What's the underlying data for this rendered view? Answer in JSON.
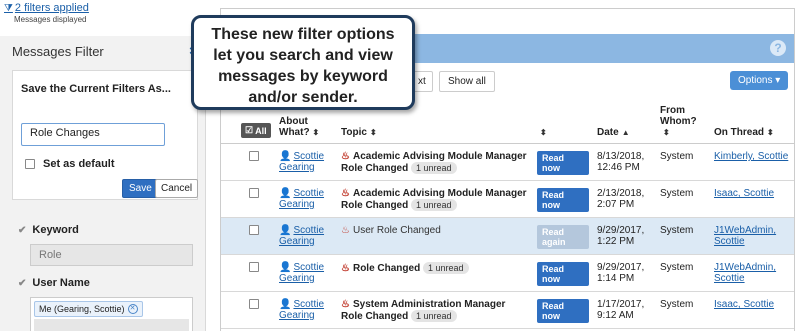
{
  "filters_applied": {
    "label": "2 filters applied",
    "sub": "Messages displayed"
  },
  "sidebar": {
    "title": "Messages Filter",
    "save_label": "Save the Current Filters As...",
    "save_value": "Role Changes",
    "set_default_label": "Set as default",
    "save_button": "Save",
    "cancel_button": "Cancel",
    "keyword_label": "Keyword",
    "keyword_value": "Role",
    "username_label": "User Name",
    "user_tag": "Me (Gearing, Scottie)"
  },
  "toolbar": {
    "next_label": "xt",
    "show_all_label": "Show all",
    "options_label": "Options ▾"
  },
  "callout": "These new filter options let you search and view messages by keyword and/or sender.",
  "table": {
    "headers": {
      "all": "All",
      "about": "About What?",
      "topic": "Topic",
      "date": "Date",
      "from": "From Whom?",
      "thread": "On Thread"
    },
    "rows": [
      {
        "about": "Scottie Gearing",
        "topic": "Academic Advising Module Manager Role Changed",
        "unread": "1 unread",
        "action": "Read now",
        "date": "8/13/2018, 12:46 PM",
        "from": "System",
        "thread": "Kimberly, Scottie"
      },
      {
        "about": "Scottie Gearing",
        "topic": "Academic Advising Module Manager Role Changed",
        "unread": "1 unread",
        "action": "Read now",
        "date": "2/13/2018, 2:07 PM",
        "from": "System",
        "thread": "Isaac, Scottie"
      },
      {
        "about": "Scottie Gearing",
        "topic": "User Role Changed",
        "unread": "",
        "action": "Read again",
        "date": "9/29/2017, 1:22 PM",
        "from": "System",
        "thread": "J1WebAdmin, Scottie"
      },
      {
        "about": "Scottie Gearing",
        "topic": "Role Changed",
        "unread": "1 unread",
        "action": "Read now",
        "date": "9/29/2017, 1:14 PM",
        "from": "System",
        "thread": "J1WebAdmin, Scottie"
      },
      {
        "about": "Scottie Gearing",
        "topic": "System Administration Manager Role Changed",
        "unread": "1 unread",
        "action": "Read now",
        "date": "1/17/2017, 9:12 AM",
        "from": "System",
        "thread": "Isaac, Scottie"
      }
    ]
  }
}
